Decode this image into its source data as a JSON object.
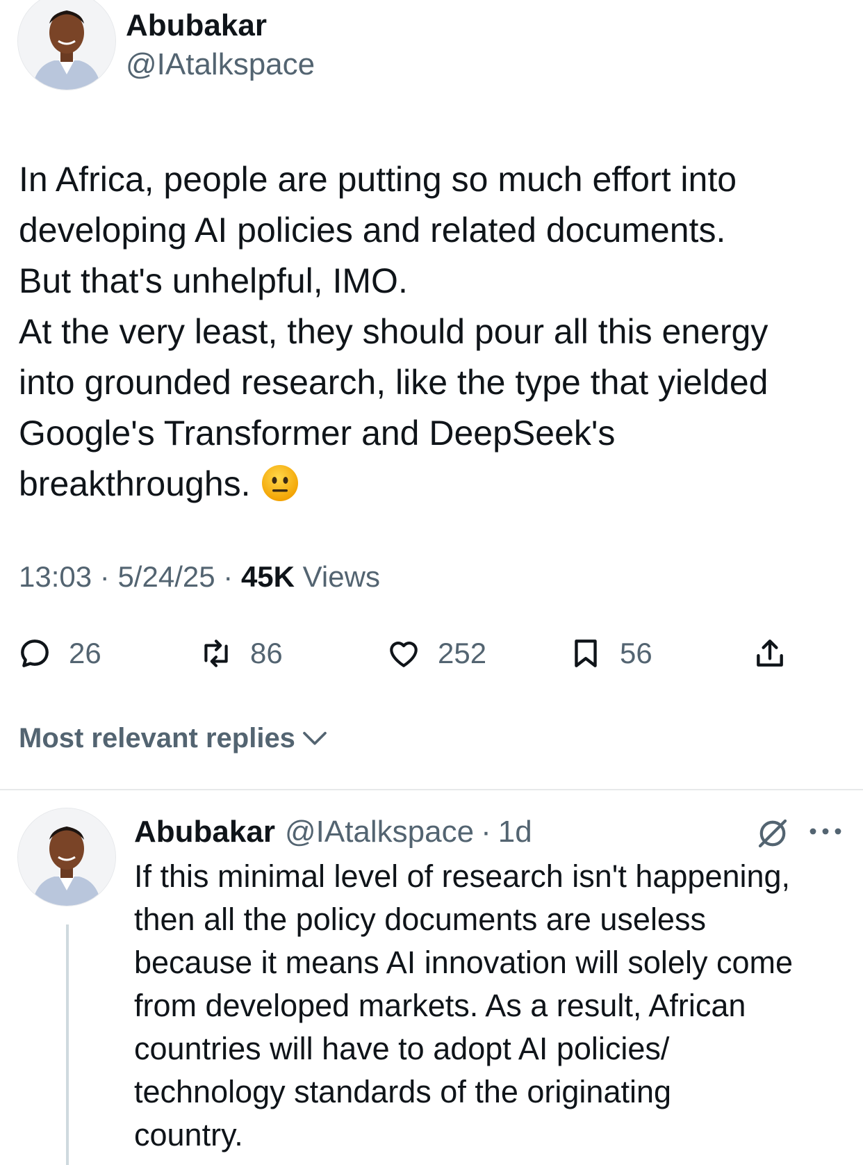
{
  "tweet": {
    "author": {
      "name": "Abubakar",
      "handle": "@IAtalkspace",
      "avatar_icon": "profile-photo"
    },
    "lines": [
      "In Africa, people are putting so much effort into",
      "developing AI policies and related documents.",
      "But that's unhelpful, IMO.",
      "At the very least, they should pour all this energy",
      "into grounded research, like the type that yielded",
      "Google's Transformer and DeepSeek's",
      "breakthroughs."
    ],
    "emoji": "neutral-face-icon",
    "time": "13:03",
    "sep1": "·",
    "date": "5/24/25",
    "sep2": "·",
    "views_count": "45K",
    "views_label": "Views",
    "stats": {
      "replies": "26",
      "reposts": "86",
      "likes": "252",
      "bookmarks": "56"
    }
  },
  "sort_label": "Most relevant replies",
  "reply": {
    "author": {
      "name": "Abubakar",
      "handle": "@IAtalkspace",
      "avatar_icon": "profile-photo"
    },
    "dot": "·",
    "time": "1d",
    "lines": [
      "If this minimal level of research isn't happening,",
      "then all the policy documents are useless",
      "because it means AI innovation will solely come",
      "from developed markets. As a result, African",
      "countries will have to adopt AI policies/",
      "technology standards of the originating",
      "country."
    ]
  },
  "colors": {
    "text": "#0f1419",
    "secondary": "#536471",
    "divider": "#e7e9ea",
    "thread_line": "#cfd9de"
  }
}
